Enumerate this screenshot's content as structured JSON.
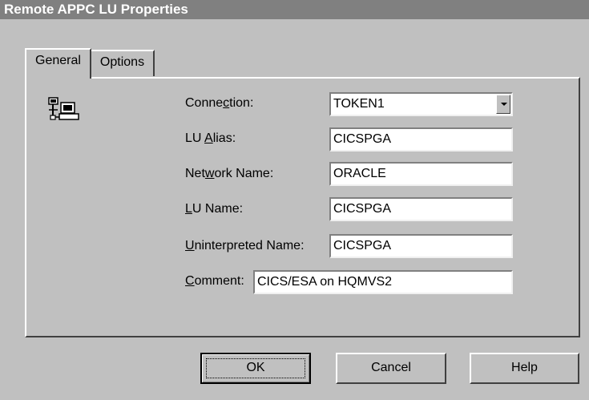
{
  "window": {
    "title": "Remote APPC LU Properties"
  },
  "tabs": [
    {
      "label": "General",
      "active": true
    },
    {
      "label": "Options",
      "active": false
    }
  ],
  "icon": {
    "name": "network-computer-icon"
  },
  "fields": {
    "connection": {
      "label_pre": "Conne",
      "label_key": "c",
      "label_post": "tion:",
      "value": "TOKEN1"
    },
    "lu_alias": {
      "label_pre": "LU ",
      "label_key": "A",
      "label_post": "lias:",
      "value": "CICSPGA"
    },
    "network_name": {
      "label_pre": "Net",
      "label_key": "w",
      "label_post": "ork Name:",
      "value": "ORACLE"
    },
    "lu_name": {
      "label_pre": "",
      "label_key": "L",
      "label_post": "U Name:",
      "value": "CICSPGA"
    },
    "uninterpreted_name": {
      "label_pre": "",
      "label_key": "U",
      "label_post": "ninterpreted Name:",
      "value": "CICSPGA"
    },
    "comment": {
      "label_pre": "",
      "label_key": "C",
      "label_post": "omment:",
      "value": "CICS/ESA on HQMVS2"
    }
  },
  "buttons": {
    "ok": "OK",
    "cancel": "Cancel",
    "help": "Help"
  },
  "colors": {
    "titlebar_bg": "#808080",
    "dialog_bg": "#c0c0c0",
    "field_bg": "#ffffff"
  }
}
